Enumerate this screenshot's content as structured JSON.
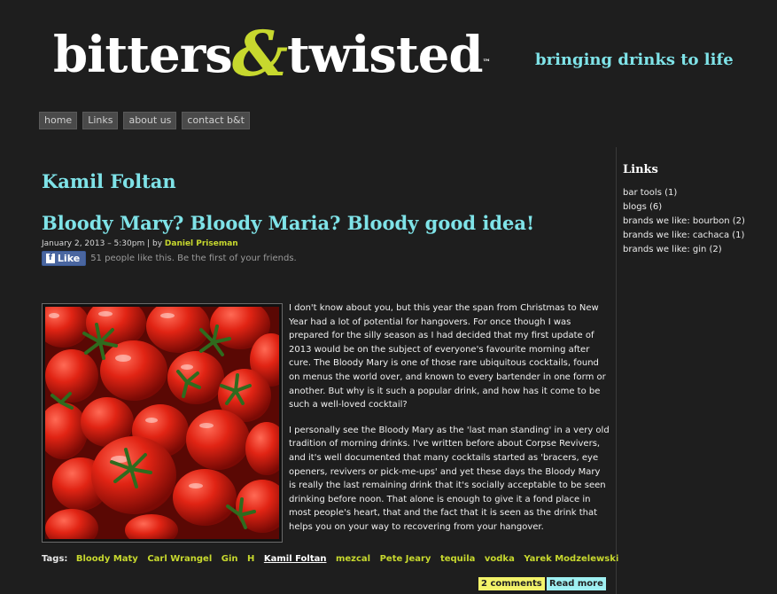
{
  "site": {
    "logo_left": "bitters",
    "logo_amp": "&",
    "logo_right": "twisted",
    "logo_tm": "™",
    "tagline": "bringing drinks to life"
  },
  "nav": [
    "home",
    "Links",
    "about us",
    "contact b&t"
  ],
  "main": {
    "author_title": "Kamil Foltan",
    "post_title": "Bloody Mary? Bloody Maria? Bloody good idea!",
    "meta_date": "January 2, 2013 – 5:30pm | by ",
    "meta_author": "Daniel Priseman",
    "like_label": "Like",
    "like_text": "51 people like this. Be the first of your friends.",
    "paragraphs": [
      "I don't know about you, but this year the span from Christmas to New Year had a lot of potential for hangovers. For once though I was prepared for the silly season as I had decided that my first update of 2013 would be on the subject of everyone's favourite morning after cure. The Bloody Mary is one of those rare ubiquitous cocktails, found on menus the world over, and known to every bartender in one form or another. But why is it such a popular drink, and how has it come to be such a well-loved cocktail?",
      "I personally see the Bloody Mary as the 'last man standing' in a very old tradition of morning drinks. I've written before about Corpse Revivers, and it's well documented that many cocktails started as 'bracers, eye openers, revivers or pick-me-ups' and yet these days the Bloody Mary is really the last remaining drink that it's socially acceptable to be seen drinking before noon. That alone is enough to give it a fond place in most people's heart, that and the fact that it is seen as the drink that helps you on your way to recovering from your hangover."
    ],
    "tags_label": "Tags:",
    "tags": [
      "Bloody Maty",
      "Carl Wrangel",
      "Gin",
      "H",
      "Kamil Foltan",
      "mezcal",
      "Pete Jeary",
      "tequila",
      "vodka",
      "Yarek Modzelewski"
    ],
    "active_tag": "Kamil Foltan",
    "comments_label": "2 comments",
    "readmore_label": "Read more"
  },
  "sidebar": {
    "title": "Links",
    "items": [
      "bar tools (1)",
      "blogs (6)",
      "brands we like: bourbon (2)",
      "brands we like: cachaca (1)",
      "brands we like: gin (2)"
    ]
  },
  "colors": {
    "background": "#1e1e1e",
    "accent_cyan": "#7fe3e8",
    "accent_lime": "#c7d82e"
  }
}
